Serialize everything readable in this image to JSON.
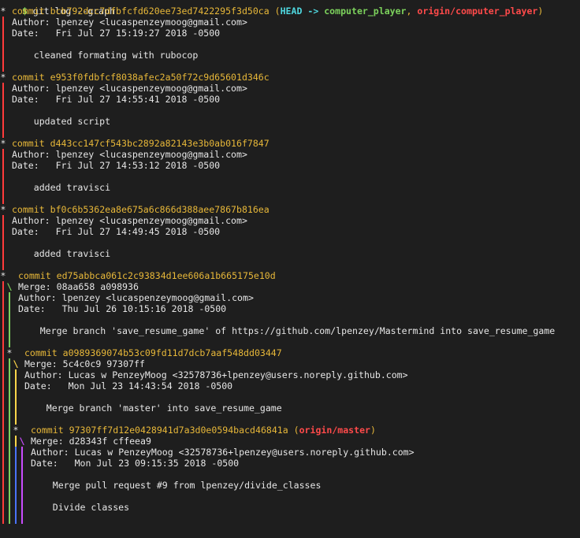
{
  "prompt": {
    "symbol": "$",
    "command": "git log --graph"
  },
  "labels": {
    "commit": "commit",
    "author": "Author:",
    "date": "Date:",
    "merge": "Merge:"
  },
  "commits": [
    {
      "hash": "bcb792dcc7dfbfcfd620ee73ed7422295f3d50ca",
      "refs": {
        "head": "HEAD",
        "arrow": "->",
        "local": "computer_player",
        "sep": ",",
        "remote": "origin/computer_player"
      },
      "author": "lpenzey <lucaspenzeymoog@gmail.com>",
      "date": "Fri Jul 27 15:19:27 2018 -0500",
      "message": "cleaned formating with rubocop"
    },
    {
      "hash": "e953f0fdbfcf8038afec2a50f72c9d65601d346c",
      "author": "lpenzey <lucaspenzeymoog@gmail.com>",
      "date": "Fri Jul 27 14:55:41 2018 -0500",
      "message": "updated script"
    },
    {
      "hash": "d443cc147cf543bc2892a82143e3b0ab016f7847",
      "author": "lpenzey <lucaspenzeymoog@gmail.com>",
      "date": "Fri Jul 27 14:53:12 2018 -0500",
      "message": "added travisci"
    },
    {
      "hash": "bf0c6b5362ea8e675a6c866d388aee7867b816ea",
      "author": "lpenzey <lucaspenzeymoog@gmail.com>",
      "date": "Fri Jul 27 14:49:45 2018 -0500",
      "message": "added travisci"
    },
    {
      "hash": "ed75abbca061c2c93834d1ee606a1b665175e10d",
      "merge": "08aa658 a098936",
      "author": "lpenzey <lucaspenzeymoog@gmail.com>",
      "date": "Thu Jul 26 10:15:16 2018 -0500",
      "message": "Merge branch 'save_resume_game' of https://github.com/lpenzey/Mastermind into save_resume_game"
    },
    {
      "hash": "a0989369074b53c09fd11d7dcb7aaf548dd03447",
      "merge": "5c4c0c9 97307ff",
      "author": "Lucas w PenzeyMoog <32578736+lpenzey@users.noreply.github.com>",
      "date": "Mon Jul 23 14:43:54 2018 -0500",
      "message": "Merge branch 'master' into save_resume_game"
    },
    {
      "hash": "97307ff7d12e0428941d7a3d0e0594bacd46841a",
      "refs": {
        "remote": "origin/master"
      },
      "merge": "d28343f cffeea9",
      "author": "Lucas w PenzeyMoog <32578736+lpenzey@users.noreply.github.com>",
      "date": "Mon Jul 23 09:15:35 2018 -0500",
      "message": "Merge pull request #9 from lpenzey/divide_classes",
      "message2": "Divide classes"
    }
  ],
  "graph_colors": {
    "red": "#ff3b3b",
    "green": "#7cd15c",
    "yellow": "#ffd54a",
    "blue": "#4a73ff",
    "magenta": "#c94cff",
    "cyan": "#4fd8e0"
  }
}
